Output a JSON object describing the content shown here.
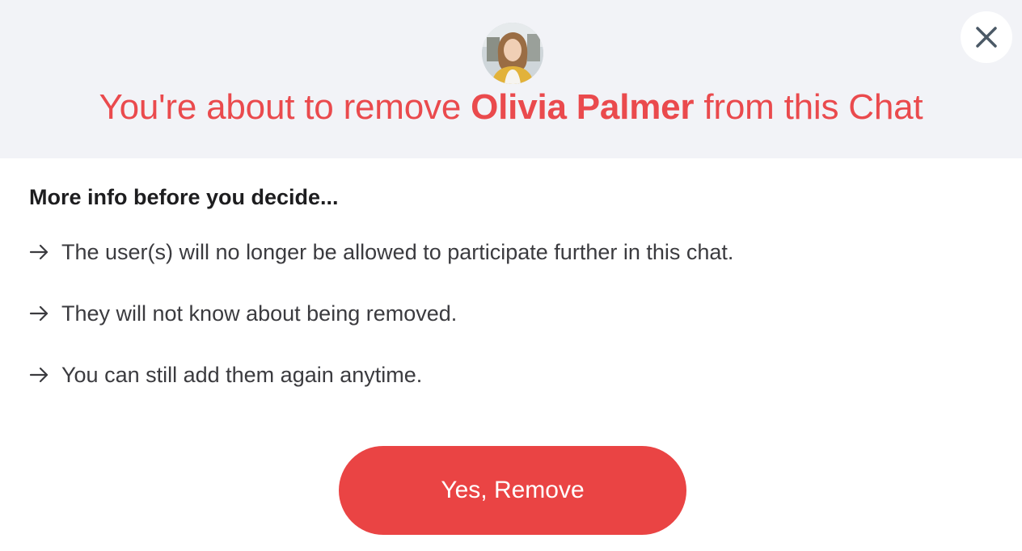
{
  "dialog": {
    "title_prefix": "You're about to remove ",
    "user_name": "Olivia Palmer",
    "title_suffix": " from this Chat",
    "avatar_icon": "user-avatar",
    "close_icon": "close-icon",
    "accent_color": "#ea4a4d"
  },
  "info": {
    "heading": "More info before you decide...",
    "items": [
      {
        "text": "The user(s) will no longer be allowed to participate further in this chat.",
        "icon": "arrow-right-icon"
      },
      {
        "text": "They will not know about being removed.",
        "icon": "arrow-right-icon"
      },
      {
        "text": "You can still add them again anytime.",
        "icon": "arrow-right-icon"
      }
    ]
  },
  "actions": {
    "confirm_label": "Yes, Remove",
    "confirm_color": "#ea4444"
  }
}
